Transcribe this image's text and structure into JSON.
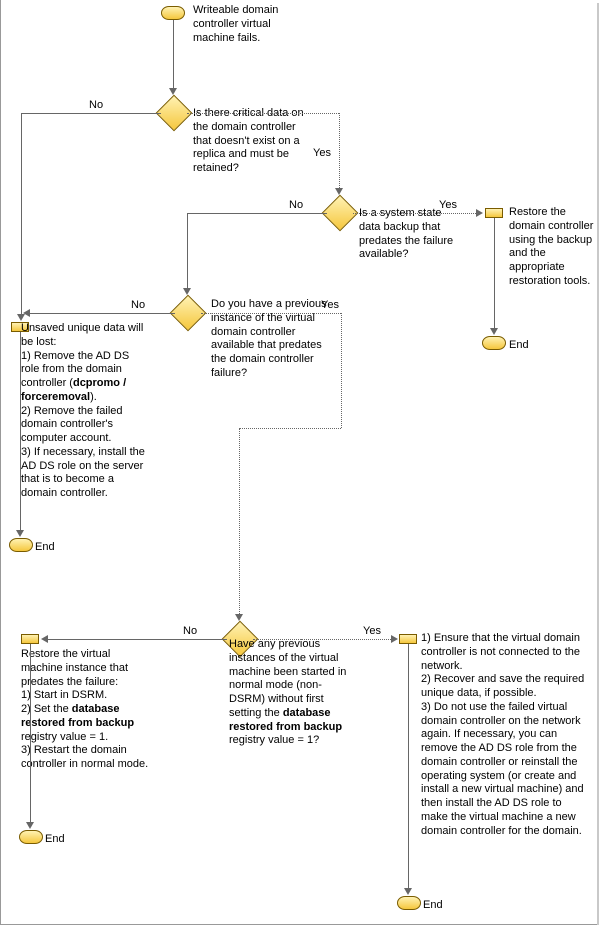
{
  "start_text": "Writeable domain controller virtual machine fails.",
  "d1_text": "Is there critical data on the domain controller that doesn't exist on a replica and must be retained?",
  "d2_text": "Is a system state data backup that predates the failure available?",
  "d3_text": "Do you have a previous instance of the virtual domain controller available that predates the domain controller failure?",
  "d4_part1": "Have any previous instances of the virtual machine been started in normal mode (non-DSRM) without first setting the ",
  "d4_bold": "database restored from backup",
  "d4_part2": " registry value = 1?",
  "outcome_restore_backup": "Restore the domain controller using the backup and the appropriate restoration tools.",
  "outcome_unsaved_header": "Unsaved unique data will be lost:",
  "outcome_unsaved_1a": "1) Remove the AD DS role from the domain controller (",
  "outcome_unsaved_1b": "dcpromo / forceremoval",
  "outcome_unsaved_1c": ").",
  "outcome_unsaved_2": "2) Remove the failed domain controller's computer account.",
  "outcome_unsaved_3": "3) If necessary, install the AD DS role on the server that is to become a domain controller.",
  "outcome_restore_instance_header": "Restore the virtual machine instance that predates the failure:",
  "outcome_restore_instance_1": "1) Start in DSRM.",
  "outcome_restore_instance_2a": "2) Set the ",
  "outcome_restore_instance_2b": "database restored from backup",
  "outcome_restore_instance_2c": " registry value = 1.",
  "outcome_restore_instance_3": "3) Restart the domain controller in normal mode.",
  "outcome_yes_d4_1": "1) Ensure that the virtual domain controller is not connected to the network.",
  "outcome_yes_d4_2": "2) Recover and save the required unique data, if possible.",
  "outcome_yes_d4_3": "3) Do not use the failed virtual domain controller on the network again. If necessary, you can remove the AD DS role from the domain controller or reinstall the operating system (or create and install a new virtual machine) and then install the AD DS role to make the virtual machine a new domain controller for the domain.",
  "labels": {
    "yes": "Yes",
    "no": "No",
    "end": "End"
  }
}
